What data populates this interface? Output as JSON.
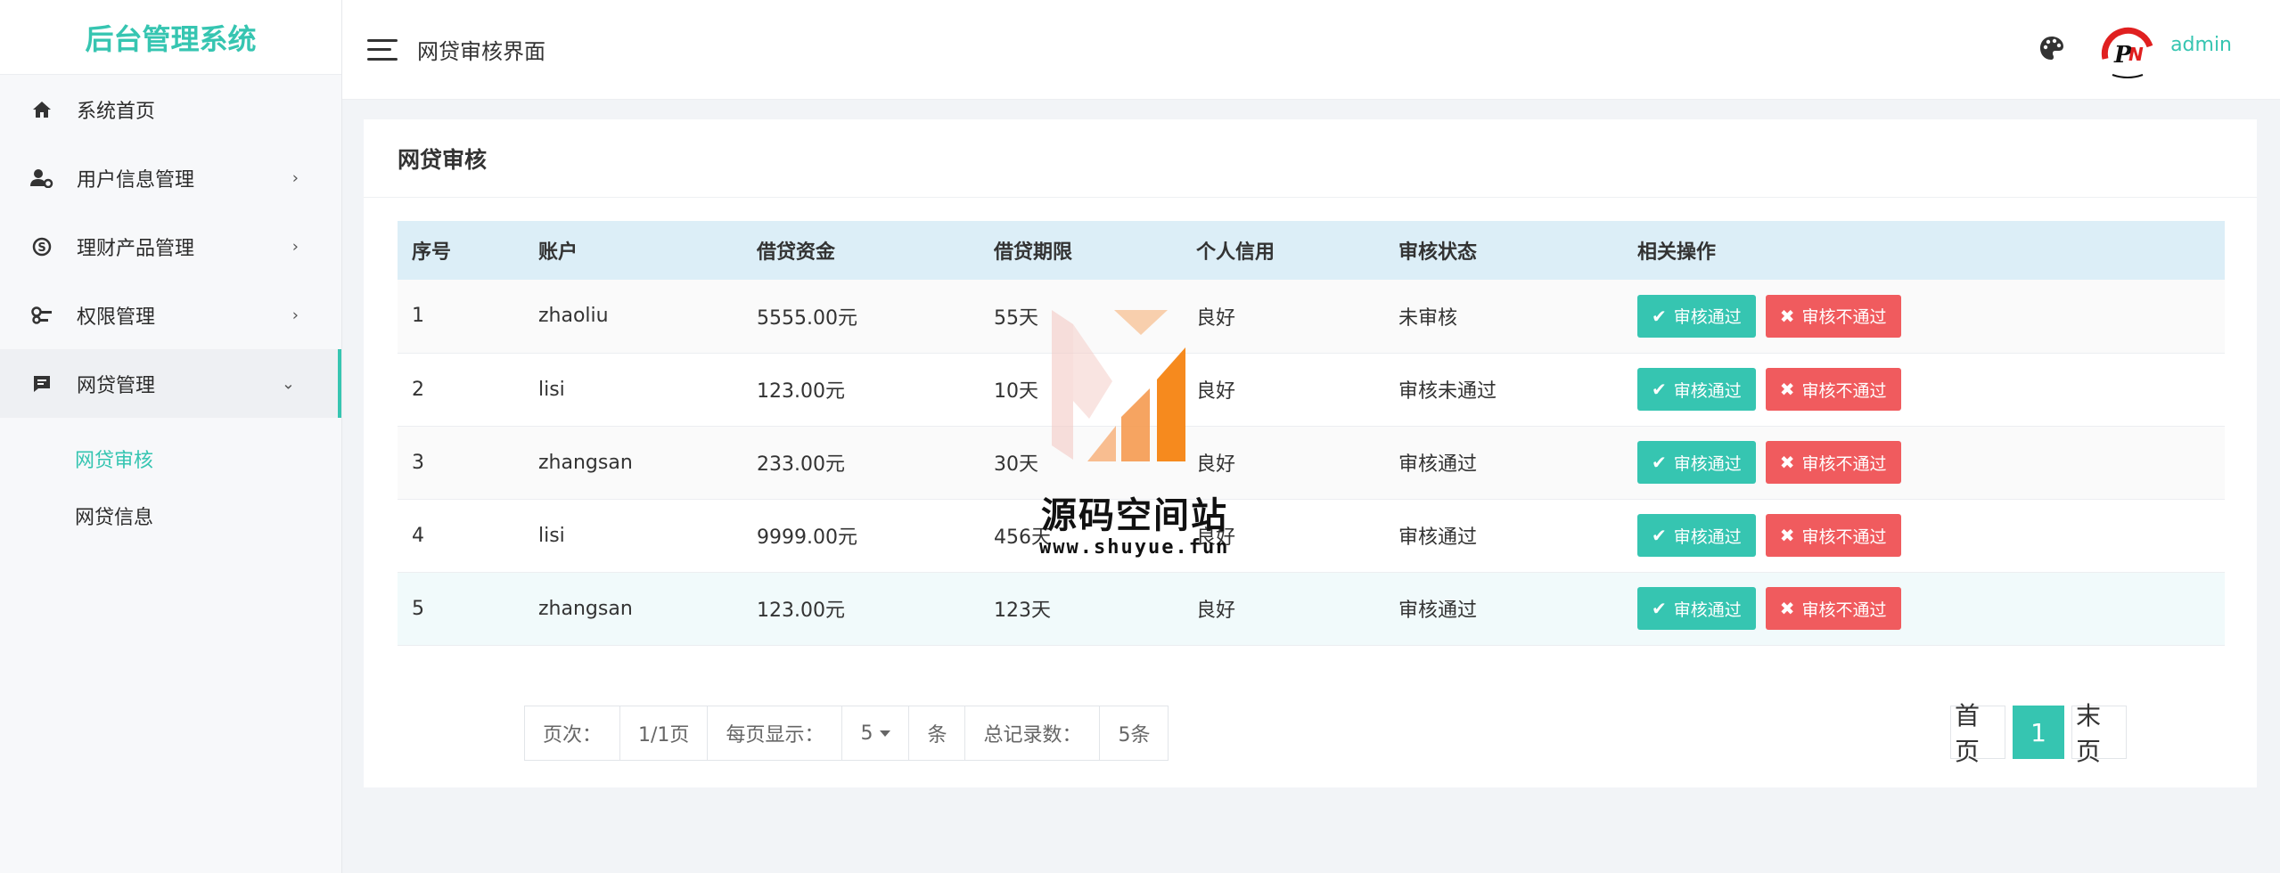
{
  "brand": "后台管理系统",
  "sidebar": {
    "items": [
      {
        "label": "系统首页",
        "icon": "home-icon"
      },
      {
        "label": "用户信息管理",
        "icon": "user-settings-icon"
      },
      {
        "label": "理财产品管理",
        "icon": "money-circle-icon"
      },
      {
        "label": "权限管理",
        "icon": "key-icon"
      },
      {
        "label": "网贷管理",
        "icon": "message-icon"
      }
    ],
    "submenu": [
      {
        "label": "网贷审核",
        "active": true
      },
      {
        "label": "网贷信息",
        "active": false
      }
    ]
  },
  "header": {
    "title": "网贷审核界面",
    "user": "admin"
  },
  "card": {
    "title": "网贷审核"
  },
  "table": {
    "columns": [
      "序号",
      "账户",
      "借贷资金",
      "借贷期限",
      "个人信用",
      "审核状态",
      "相关操作"
    ],
    "rows": [
      [
        "1",
        "zhaoliu",
        "5555.00元",
        "55天",
        "良好",
        "未审核"
      ],
      [
        "2",
        "lisi",
        "123.00元",
        "10天",
        "良好",
        "审核未通过"
      ],
      [
        "3",
        "zhangsan",
        "233.00元",
        "30天",
        "良好",
        "审核通过"
      ],
      [
        "4",
        "lisi",
        "9999.00元",
        "456天",
        "良好",
        "审核通过"
      ],
      [
        "5",
        "zhangsan",
        "123.00元",
        "123天",
        "良好",
        "审核通过"
      ]
    ],
    "pass_label": "审核通过",
    "fail_label": "审核不通过"
  },
  "pagination_info": {
    "page_label": "页次：",
    "page_value": "1/1页",
    "per_page_label": "每页显示：",
    "per_page_value": "5",
    "unit": "条",
    "total_label": "总记录数：",
    "total_value": "5条"
  },
  "pager": {
    "first": "首页",
    "current": "1",
    "last": "末页"
  },
  "watermark": {
    "text": "源码空间站",
    "url": "www.shuyue.fun"
  },
  "colors": {
    "accent": "#36c5b1",
    "danger": "#f05b5e",
    "table_header": "#dceef7"
  }
}
